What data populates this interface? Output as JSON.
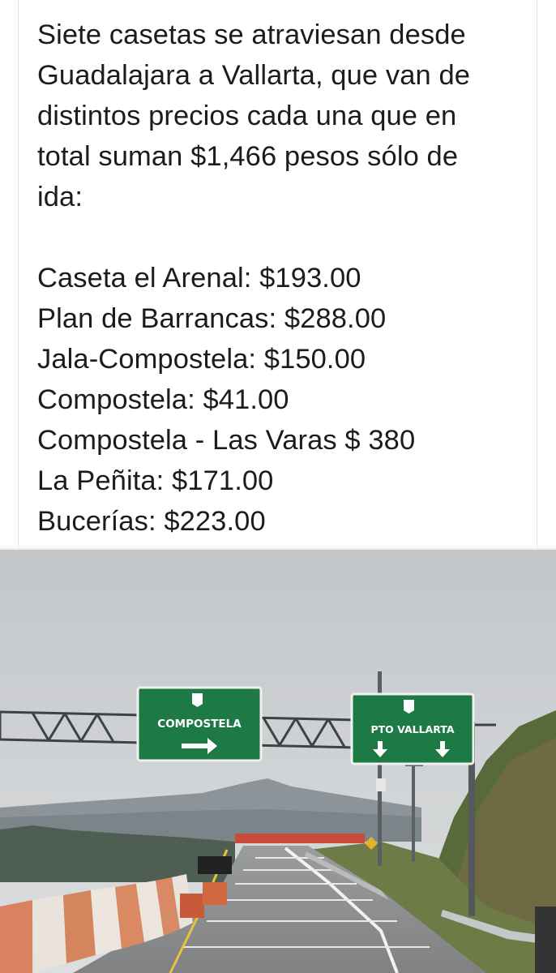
{
  "post": {
    "intro_lines": [
      "Siete casetas se atraviesan desde",
      "Guadalajara a Vallarta, que van de",
      "distintos precios cada una que en",
      "total suman $1,466 pesos sólo de",
      "ida:"
    ],
    "tolls": [
      "Caseta el Arenal: $193.00",
      "Plan de Barrancas: $288.00",
      "Jala-Compostela: $150.00",
      "Compostela: $41.00",
      "Compostela - Las Varas $ 380",
      "La Peñita: $171.00",
      "Bucerías: $223.00"
    ]
  },
  "photo": {
    "sign_left": {
      "label": "COMPOSTELA",
      "arrow": "right-arrow"
    },
    "sign_right": {
      "label": "PTO VALLARTA",
      "arrows": [
        "down-arrow",
        "down-arrow"
      ]
    },
    "colors": {
      "sign_green": "#1e7a44",
      "sky": "#cfd2d4",
      "road": "#8a8c8e"
    }
  }
}
